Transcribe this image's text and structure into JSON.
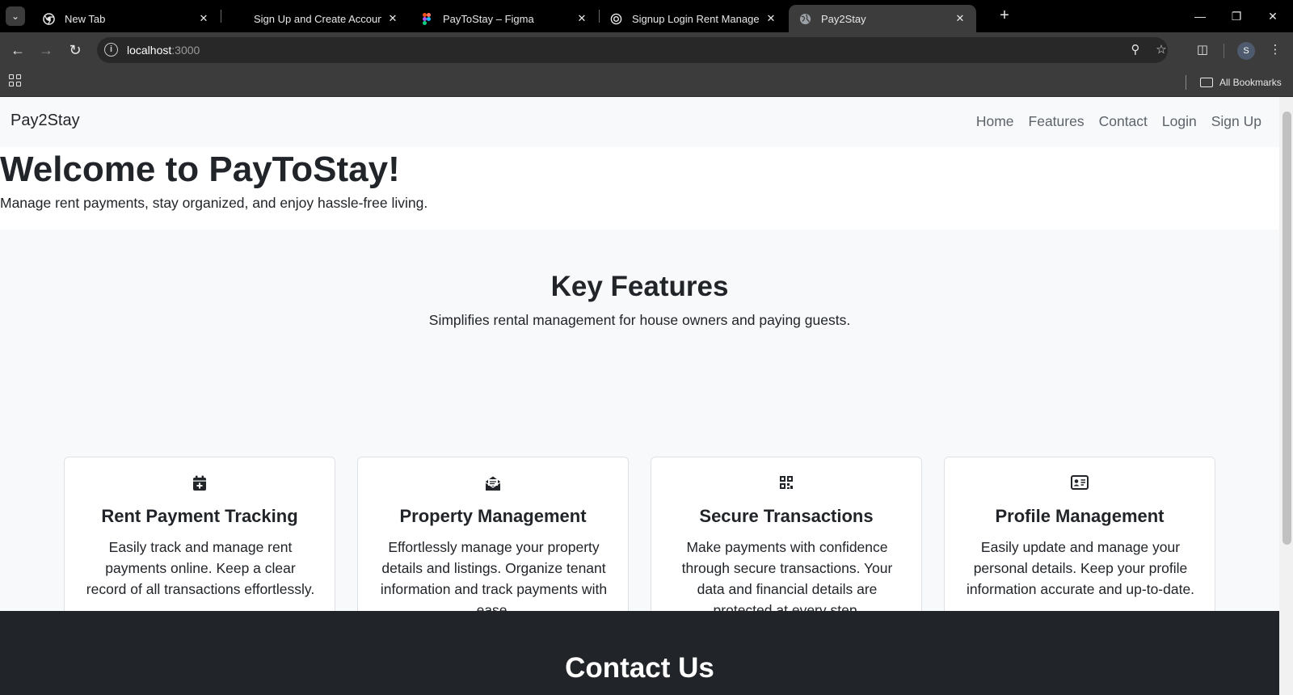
{
  "browser": {
    "tabs": [
      {
        "title": "New Tab",
        "favicon": "chrome-icon",
        "active": false
      },
      {
        "title": "Sign Up and Create Account - S",
        "favicon": "blank-icon",
        "active": false
      },
      {
        "title": "PayToStay – Figma",
        "favicon": "figma-icon",
        "active": false
      },
      {
        "title": "Signup Login Rent Managemen",
        "favicon": "openai-icon",
        "active": false
      },
      {
        "title": "Pay2Stay",
        "favicon": "globe-icon",
        "active": true
      }
    ],
    "url_host": "localhost",
    "url_port": ":3000",
    "bookmarks_label": "All Bookmarks",
    "profile_initial": "S",
    "colors": {
      "tabstrip": "#000000",
      "toolbar": "#3c3c3c",
      "omnibox": "#282828"
    }
  },
  "site": {
    "brand": "Pay2Stay",
    "nav": [
      "Home",
      "Features",
      "Contact",
      "Login",
      "Sign Up"
    ],
    "hero": {
      "title": "Welcome to PayToStay!",
      "subtitle": "Manage rent payments, stay organized, and enjoy hassle-free living."
    },
    "features": {
      "title": "Key Features",
      "subtitle": "Simplifies rental management for house owners and paying guests.",
      "cards": [
        {
          "icon": "calendar-plus-icon",
          "title": "Rent Payment Tracking",
          "text": "Easily track and manage rent payments online. Keep a clear record of all transactions effortlessly."
        },
        {
          "icon": "envelope-open-icon",
          "title": "Property Management",
          "text": "Effortlessly manage your property details and listings. Organize tenant information and track payments with ease."
        },
        {
          "icon": "qr-code-icon",
          "title": "Secure Transactions",
          "text": "Make payments with confidence through secure transactions. Your data and financial details are protected at every step."
        },
        {
          "icon": "id-card-icon",
          "title": "Profile Management",
          "text": "Easily update and manage your personal details. Keep your profile information accurate and up-to-date."
        }
      ]
    },
    "contact": {
      "title": "Contact Us"
    },
    "colors": {
      "nav_bg": "#f8f9fa",
      "text": "#212529",
      "nav_link": "#5c636a",
      "contact_bg": "#212529"
    }
  }
}
